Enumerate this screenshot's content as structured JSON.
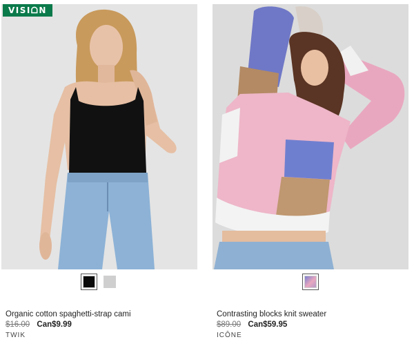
{
  "products": [
    {
      "badge": "VISIᗝN",
      "image_desc_icon": "product-photo",
      "swatch_colors": [
        "#0a0a0a",
        "#cfcfcf"
      ],
      "name": "Organic cotton spaghetti-strap cami",
      "old_price": "$16.00",
      "new_price": "Can$9.99",
      "brand": "TWIK"
    },
    {
      "swatch_colors": [
        "#b59ac9"
      ],
      "name": "Contrasting blocks knit sweater",
      "old_price": "$89.00",
      "new_price": "Can$59.95",
      "brand": "ICÔNE"
    }
  ]
}
